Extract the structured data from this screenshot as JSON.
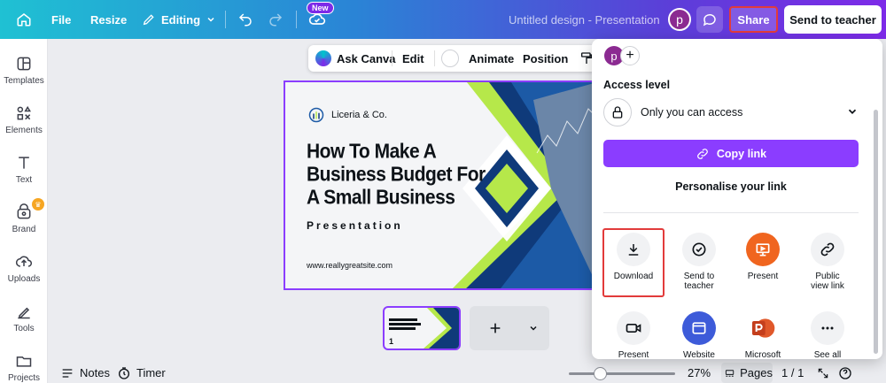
{
  "topbar": {
    "file": "File",
    "resize": "Resize",
    "editing": "Editing",
    "new_badge": "New",
    "doc_title": "Untitled design - Presentation",
    "avatar_initial": "p",
    "share": "Share",
    "send_to_teacher": "Send to teacher"
  },
  "sidebar": {
    "items": [
      {
        "label": "Templates",
        "icon": "templates-icon"
      },
      {
        "label": "Elements",
        "icon": "elements-icon"
      },
      {
        "label": "Text",
        "icon": "text-icon"
      },
      {
        "label": "Brand",
        "icon": "brand-icon"
      },
      {
        "label": "Uploads",
        "icon": "uploads-icon"
      },
      {
        "label": "Tools",
        "icon": "tools-icon"
      },
      {
        "label": "Projects",
        "icon": "projects-icon"
      }
    ]
  },
  "context_toolbar": {
    "ask_canva": "Ask Canva",
    "edit": "Edit",
    "animate": "Animate",
    "position": "Position"
  },
  "slide": {
    "brand": "Liceria & Co.",
    "title": "How To Make A Business Budget For A Small Business",
    "subtitle": "Presentation",
    "url": "www.reallygreatsite.com"
  },
  "pages": {
    "thumb_number": "1"
  },
  "footer": {
    "notes": "Notes",
    "timer": "Timer",
    "zoom": "27%",
    "pages": "Pages",
    "page_count": "1 / 1",
    "zoom_level": 0.27
  },
  "share_panel": {
    "avatar_initial": "p",
    "access_level_label": "Access level",
    "access_value": "Only you can access",
    "copy_link": "Copy link",
    "personalise": "Personalise your link",
    "options": [
      {
        "label": "Download",
        "icon": "download-icon"
      },
      {
        "label": "Send to teacher",
        "icon": "check-circle-icon"
      },
      {
        "label": "Present",
        "icon": "present-icon"
      },
      {
        "label": "Public view link",
        "icon": "link-icon"
      },
      {
        "label": "Present",
        "icon": "video-icon"
      },
      {
        "label": "Website",
        "icon": "website-icon"
      },
      {
        "label": "Microsoft",
        "icon": "powerpoint-icon"
      },
      {
        "label": "See all",
        "icon": "more-icon"
      }
    ]
  },
  "colors": {
    "accent": "#8b3dff",
    "highlight": "#e23b3b",
    "slide_navy": "#0f3a7a",
    "slide_lime": "#b6e84a"
  }
}
